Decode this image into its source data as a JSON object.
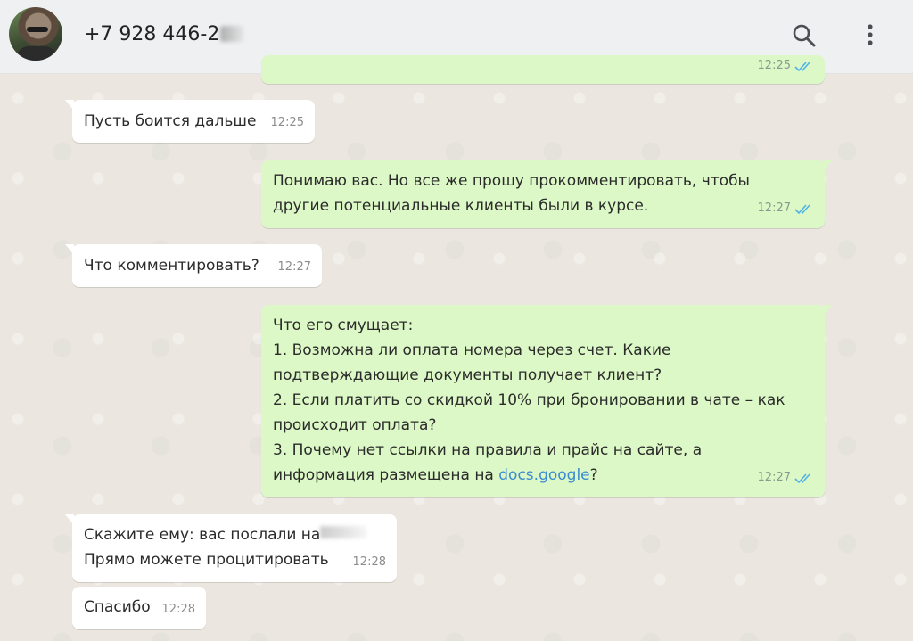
{
  "header": {
    "contact_name": "+7 928 446-2",
    "search_icon": "search-icon",
    "menu_icon": "more-vertical-icon"
  },
  "colors": {
    "outgoing_bubble": "#dcf8c6",
    "incoming_bubble": "#ffffff",
    "read_ticks": "#4fb3e8",
    "link": "#3a8bd1",
    "header_bg": "#eef0f1"
  },
  "messages": [
    {
      "direction": "out",
      "text": "",
      "time": "12:25",
      "status": "read"
    },
    {
      "direction": "in",
      "text": "Пусть боится дальше",
      "time": "12:25"
    },
    {
      "direction": "out",
      "lines": [
        "Понимаю вас. Но все же прошу прокомментировать, чтобы",
        "другие потенциальные клиенты были в курсе."
      ],
      "time": "12:27",
      "status": "read"
    },
    {
      "direction": "in",
      "text": "Что комментировать?",
      "time": "12:27"
    },
    {
      "direction": "out",
      "lines": [
        "Что его смущает:",
        "1. Возможна ли оплата номера через счет. Какие",
        "подтверждающие документы получает клиент?",
        "2. Если платить со скидкой 10% при бронировании в чате – как",
        "происходит оплата?",
        "3. Почему нет ссылки на правила и прайс на сайте, а"
      ],
      "last_line_prefix": "информация размещена на ",
      "link_text": "docs.google",
      "last_line_suffix": "?",
      "time": "12:27",
      "status": "read"
    },
    {
      "direction": "in",
      "line1": "Скажите ему: вас послали на",
      "line2": "Прямо можете процитировать",
      "time": "12:28"
    },
    {
      "direction": "in",
      "text": "Спасибо",
      "time": "12:28"
    }
  ]
}
